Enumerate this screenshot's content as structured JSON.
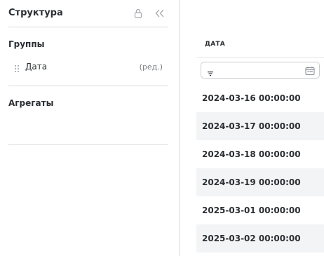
{
  "structure_panel": {
    "title": "Структура",
    "lock_icon": "lock-icon",
    "collapse_icon": "double-chevron-left-icon",
    "groups": {
      "title": "Группы",
      "items": [
        {
          "label": "Дата",
          "edit_label": "(ред.)"
        }
      ]
    },
    "aggregates": {
      "title": "Агрегаты"
    }
  },
  "data_column": {
    "header": "ДАТА",
    "filter": {
      "value": "",
      "filter_icon": "filter-icon",
      "calendar_icon": "calendar-icon"
    },
    "rows": [
      "2024-03-16 00:00:00",
      "2024-03-17 00:00:00",
      "2024-03-18 00:00:00",
      "2024-03-19 00:00:00",
      "2025-03-01 00:00:00",
      "2025-03-02 00:00:00"
    ]
  },
  "colors": {
    "text": "#2b2f33",
    "muted": "#7a7f86",
    "divider": "#d8dadd",
    "alt_row": "#f3f4f6"
  }
}
